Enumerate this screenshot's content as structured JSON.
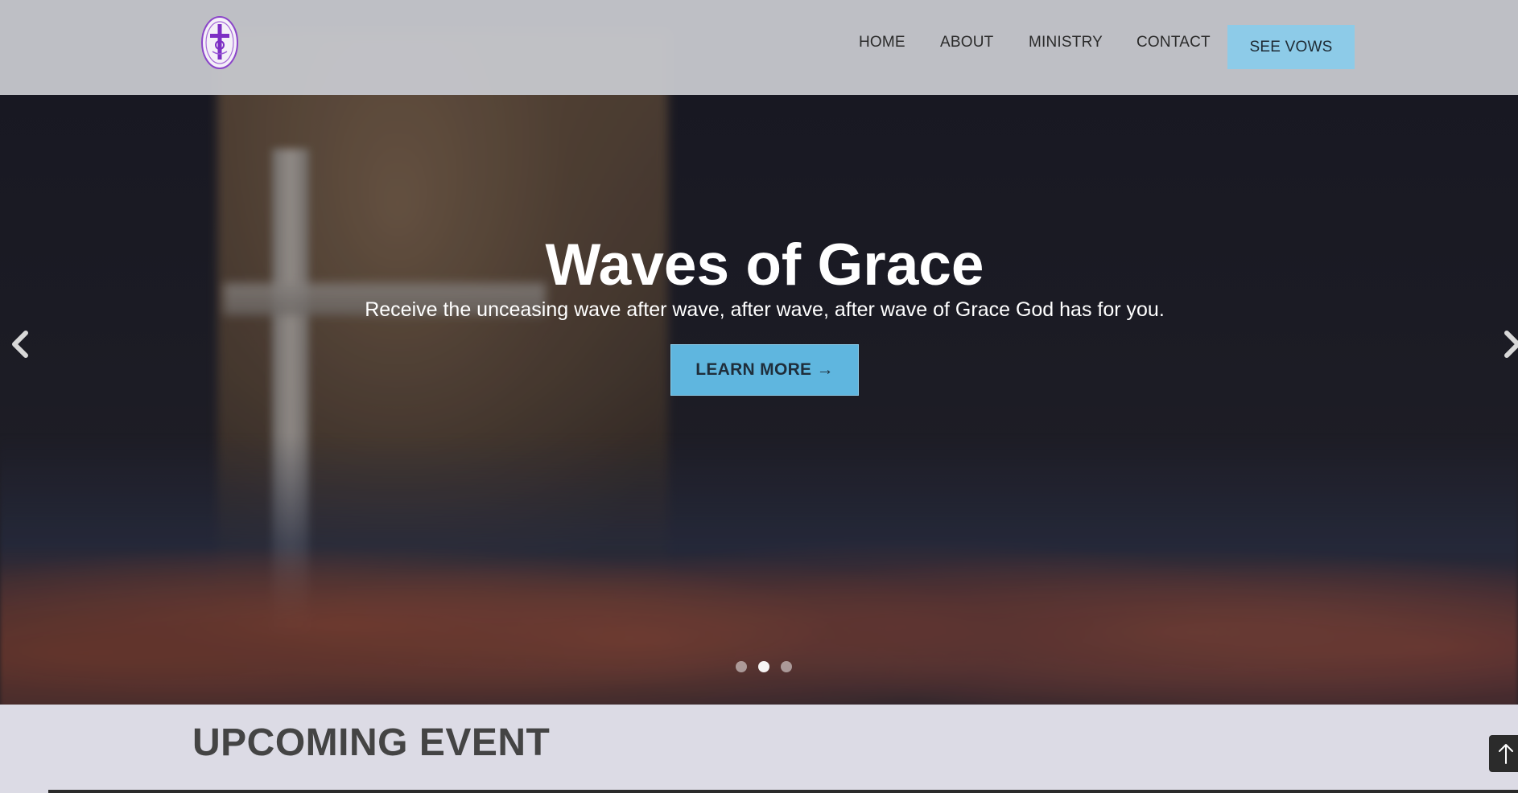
{
  "header": {
    "logo_icon": "church-seal-logo",
    "nav": {
      "home": "HOME",
      "about": "ABOUT",
      "ministry": "MINISTRY",
      "contact": "CONTACT"
    },
    "cta_label": "SEE VOWS",
    "cta_color": "#8dcbe8"
  },
  "hero": {
    "title": "Waves of Grace",
    "subtitle": "Receive the unceasing wave after wave, after wave, after wave of Grace God has for you.",
    "button_label": "LEARN MORE →",
    "button_color": "#5fb6df",
    "prev_icon": "chevron-left-icon",
    "next_icon": "chevron-right-icon",
    "slide_count": 3,
    "active_slide": 2
  },
  "upcoming": {
    "title": "UPCOMING EVENT"
  },
  "back_to_top_icon": "arrow-up-icon"
}
